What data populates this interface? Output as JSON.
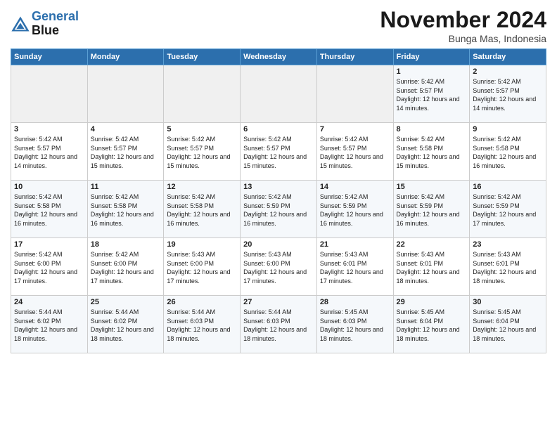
{
  "header": {
    "logo_line1": "General",
    "logo_line2": "Blue",
    "month_title": "November 2024",
    "location": "Bunga Mas, Indonesia"
  },
  "weekdays": [
    "Sunday",
    "Monday",
    "Tuesday",
    "Wednesday",
    "Thursday",
    "Friday",
    "Saturday"
  ],
  "weeks": [
    [
      {
        "day": "",
        "empty": true
      },
      {
        "day": "",
        "empty": true
      },
      {
        "day": "",
        "empty": true
      },
      {
        "day": "",
        "empty": true
      },
      {
        "day": "",
        "empty": true
      },
      {
        "day": "1",
        "sunrise": "5:42 AM",
        "sunset": "5:57 PM",
        "daylight": "12 hours and 14 minutes."
      },
      {
        "day": "2",
        "sunrise": "5:42 AM",
        "sunset": "5:57 PM",
        "daylight": "12 hours and 14 minutes."
      }
    ],
    [
      {
        "day": "3",
        "sunrise": "5:42 AM",
        "sunset": "5:57 PM",
        "daylight": "12 hours and 14 minutes."
      },
      {
        "day": "4",
        "sunrise": "5:42 AM",
        "sunset": "5:57 PM",
        "daylight": "12 hours and 15 minutes."
      },
      {
        "day": "5",
        "sunrise": "5:42 AM",
        "sunset": "5:57 PM",
        "daylight": "12 hours and 15 minutes."
      },
      {
        "day": "6",
        "sunrise": "5:42 AM",
        "sunset": "5:57 PM",
        "daylight": "12 hours and 15 minutes."
      },
      {
        "day": "7",
        "sunrise": "5:42 AM",
        "sunset": "5:57 PM",
        "daylight": "12 hours and 15 minutes."
      },
      {
        "day": "8",
        "sunrise": "5:42 AM",
        "sunset": "5:58 PM",
        "daylight": "12 hours and 15 minutes."
      },
      {
        "day": "9",
        "sunrise": "5:42 AM",
        "sunset": "5:58 PM",
        "daylight": "12 hours and 16 minutes."
      }
    ],
    [
      {
        "day": "10",
        "sunrise": "5:42 AM",
        "sunset": "5:58 PM",
        "daylight": "12 hours and 16 minutes."
      },
      {
        "day": "11",
        "sunrise": "5:42 AM",
        "sunset": "5:58 PM",
        "daylight": "12 hours and 16 minutes."
      },
      {
        "day": "12",
        "sunrise": "5:42 AM",
        "sunset": "5:58 PM",
        "daylight": "12 hours and 16 minutes."
      },
      {
        "day": "13",
        "sunrise": "5:42 AM",
        "sunset": "5:59 PM",
        "daylight": "12 hours and 16 minutes."
      },
      {
        "day": "14",
        "sunrise": "5:42 AM",
        "sunset": "5:59 PM",
        "daylight": "12 hours and 16 minutes."
      },
      {
        "day": "15",
        "sunrise": "5:42 AM",
        "sunset": "5:59 PM",
        "daylight": "12 hours and 16 minutes."
      },
      {
        "day": "16",
        "sunrise": "5:42 AM",
        "sunset": "5:59 PM",
        "daylight": "12 hours and 17 minutes."
      }
    ],
    [
      {
        "day": "17",
        "sunrise": "5:42 AM",
        "sunset": "6:00 PM",
        "daylight": "12 hours and 17 minutes."
      },
      {
        "day": "18",
        "sunrise": "5:42 AM",
        "sunset": "6:00 PM",
        "daylight": "12 hours and 17 minutes."
      },
      {
        "day": "19",
        "sunrise": "5:43 AM",
        "sunset": "6:00 PM",
        "daylight": "12 hours and 17 minutes."
      },
      {
        "day": "20",
        "sunrise": "5:43 AM",
        "sunset": "6:00 PM",
        "daylight": "12 hours and 17 minutes."
      },
      {
        "day": "21",
        "sunrise": "5:43 AM",
        "sunset": "6:01 PM",
        "daylight": "12 hours and 17 minutes."
      },
      {
        "day": "22",
        "sunrise": "5:43 AM",
        "sunset": "6:01 PM",
        "daylight": "12 hours and 18 minutes."
      },
      {
        "day": "23",
        "sunrise": "5:43 AM",
        "sunset": "6:01 PM",
        "daylight": "12 hours and 18 minutes."
      }
    ],
    [
      {
        "day": "24",
        "sunrise": "5:44 AM",
        "sunset": "6:02 PM",
        "daylight": "12 hours and 18 minutes."
      },
      {
        "day": "25",
        "sunrise": "5:44 AM",
        "sunset": "6:02 PM",
        "daylight": "12 hours and 18 minutes."
      },
      {
        "day": "26",
        "sunrise": "5:44 AM",
        "sunset": "6:03 PM",
        "daylight": "12 hours and 18 minutes."
      },
      {
        "day": "27",
        "sunrise": "5:44 AM",
        "sunset": "6:03 PM",
        "daylight": "12 hours and 18 minutes."
      },
      {
        "day": "28",
        "sunrise": "5:45 AM",
        "sunset": "6:03 PM",
        "daylight": "12 hours and 18 minutes."
      },
      {
        "day": "29",
        "sunrise": "5:45 AM",
        "sunset": "6:04 PM",
        "daylight": "12 hours and 18 minutes."
      },
      {
        "day": "30",
        "sunrise": "5:45 AM",
        "sunset": "6:04 PM",
        "daylight": "12 hours and 18 minutes."
      }
    ]
  ]
}
